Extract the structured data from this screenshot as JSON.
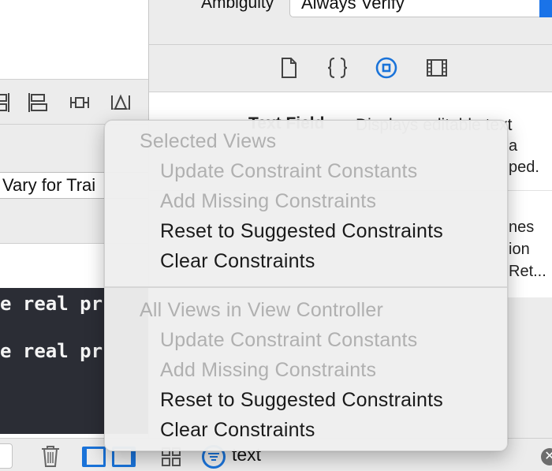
{
  "inspector": {
    "ambiguity_label": "Ambiguity",
    "ambiguity_value": "Always Verify",
    "library_item_title": "Text Field",
    "library_item_desc_line1": "Displays editable text",
    "library_frag_a": "a",
    "library_frag_b": "ped.",
    "library_frag_c": "nes",
    "library_frag_d": "ion",
    "library_frag_e": "Ret..."
  },
  "editor": {
    "vary_for_traits": "Vary for Trai",
    "code_line_1": "e real pr",
    "code_line_2": "e real pr"
  },
  "bottom_bar": {
    "filter_text": "text",
    "clear_glyph": "✕"
  },
  "menu": {
    "section1_header": "Selected Views",
    "section1_items": [
      {
        "label": "Update Constraint Constants",
        "enabled": false
      },
      {
        "label": "Add Missing Constraints",
        "enabled": false
      },
      {
        "label": "Reset to Suggested Constraints",
        "enabled": true
      },
      {
        "label": "Clear Constraints",
        "enabled": true
      }
    ],
    "section2_header": "All Views in View Controller",
    "section2_items": [
      {
        "label": "Update Constraint Constants",
        "enabled": false
      },
      {
        "label": "Add Missing Constraints",
        "enabled": false
      },
      {
        "label": "Reset to Suggested Constraints",
        "enabled": true
      },
      {
        "label": "Clear Constraints",
        "enabled": true
      }
    ]
  },
  "colors": {
    "accent": "#1a73d9",
    "disabled_text": "#b0b0b0",
    "enabled_text": "#1a1a1a",
    "code_bg": "#2b2d35"
  },
  "icons": {
    "lib_tabs": [
      "file-icon",
      "braces-icon",
      "object-library-icon",
      "media-library-icon"
    ],
    "layout_bar": [
      "align-icon",
      "stack-icon",
      "pin-icon",
      "resolve-issues-icon"
    ]
  }
}
